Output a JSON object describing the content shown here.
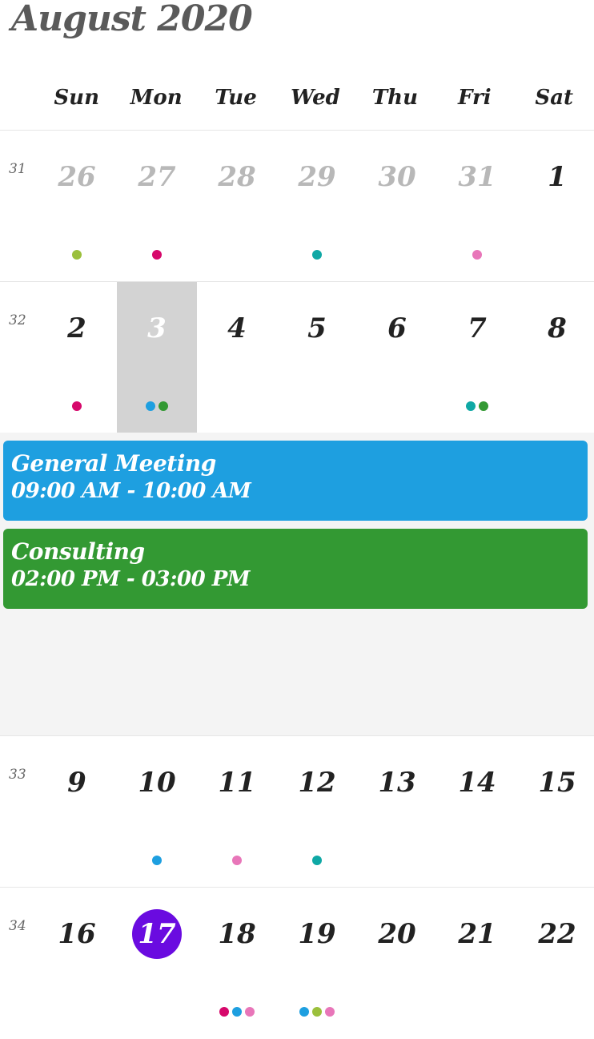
{
  "header": {
    "title": "August 2020"
  },
  "weekdays": [
    "Sun",
    "Mon",
    "Tue",
    "Wed",
    "Thu",
    "Fri",
    "Sat"
  ],
  "colors": {
    "lime": "#9bc03c",
    "magenta": "#d6086b",
    "teal": "#0fa8a5",
    "pink": "#e876b9",
    "blue": "#1e9fe0",
    "green": "#339933",
    "today": "#6a0be0",
    "selected": "#d3d3d3"
  },
  "weeks": [
    {
      "number": "31",
      "days": [
        {
          "label": "26",
          "other": true,
          "dots": [
            "lime"
          ]
        },
        {
          "label": "27",
          "other": true,
          "dots": [
            "magenta"
          ]
        },
        {
          "label": "28",
          "other": true,
          "dots": []
        },
        {
          "label": "29",
          "other": true,
          "dots": [
            "teal"
          ]
        },
        {
          "label": "30",
          "other": true,
          "dots": []
        },
        {
          "label": "31",
          "other": true,
          "dots": [
            "pink"
          ]
        },
        {
          "label": "1",
          "dots": []
        }
      ]
    },
    {
      "number": "32",
      "days": [
        {
          "label": "2",
          "dots": [
            "magenta"
          ]
        },
        {
          "label": "3",
          "selected": true,
          "dots": [
            "blue",
            "green"
          ]
        },
        {
          "label": "4",
          "dots": []
        },
        {
          "label": "5",
          "dots": []
        },
        {
          "label": "6",
          "dots": []
        },
        {
          "label": "7",
          "dots": [
            "teal",
            "green"
          ]
        },
        {
          "label": "8",
          "dots": []
        }
      ]
    },
    {
      "number": "33",
      "days": [
        {
          "label": "9",
          "dots": []
        },
        {
          "label": "10",
          "dots": [
            "blue"
          ]
        },
        {
          "label": "11",
          "dots": [
            "pink"
          ]
        },
        {
          "label": "12",
          "dots": [
            "teal"
          ]
        },
        {
          "label": "13",
          "dots": []
        },
        {
          "label": "14",
          "dots": []
        },
        {
          "label": "15",
          "dots": []
        }
      ]
    },
    {
      "number": "34",
      "days": [
        {
          "label": "16",
          "dots": []
        },
        {
          "label": "17",
          "today": true,
          "dots": []
        },
        {
          "label": "18",
          "dots": [
            "magenta",
            "blue",
            "pink"
          ]
        },
        {
          "label": "19",
          "dots": [
            "blue",
            "lime",
            "pink"
          ]
        },
        {
          "label": "20",
          "dots": []
        },
        {
          "label": "21",
          "dots": []
        },
        {
          "label": "22",
          "dots": []
        }
      ]
    }
  ],
  "events": [
    {
      "title": "General Meeting",
      "time": "09:00 AM - 10:00 AM",
      "color": "blue"
    },
    {
      "title": "Consulting",
      "time": "02:00 PM - 03:00 PM",
      "color": "green"
    }
  ]
}
